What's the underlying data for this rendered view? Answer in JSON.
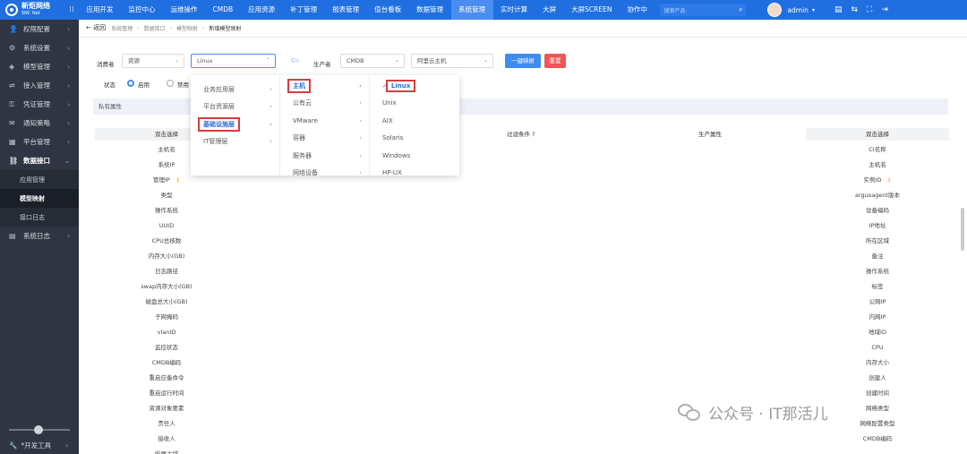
{
  "app": {
    "logo_line1": "新炬网络",
    "logo_line2": "SNC Net"
  },
  "nav": {
    "items": [
      "应用开发",
      "监控中心",
      "运维操作",
      "CMDB",
      "应用资源",
      "补丁管理",
      "报表管理",
      "值台看板",
      "数据管理",
      "系统管理",
      "实时计算",
      "大屏",
      "大屏SCREEN",
      "协作中"
    ],
    "active_index": 9,
    "search_placeholder": "搜索产品",
    "user": "admin"
  },
  "sidebar": {
    "items": [
      {
        "label": "权限配置",
        "icon": "user-icon"
      },
      {
        "label": "系统设置",
        "icon": "gear-icon"
      },
      {
        "label": "模型管理",
        "icon": "cube-icon"
      },
      {
        "label": "接入管理",
        "icon": "plug-icon"
      },
      {
        "label": "凭证管理",
        "icon": "key-icon"
      },
      {
        "label": "通知策略",
        "icon": "bell-icon"
      },
      {
        "label": "平台管理",
        "icon": "grid-icon"
      },
      {
        "label": "数据接口",
        "icon": "link-icon"
      }
    ],
    "subitems": [
      "应用管理",
      "模型映射",
      "接口日志"
    ],
    "active_sub": 1,
    "last_item": "系统日志",
    "dev_tools": "*开发工具"
  },
  "breadcrumb": {
    "back": "← 返回",
    "items": [
      "系统管理",
      "数据接口",
      "模型映射",
      "新增模型映射"
    ]
  },
  "form": {
    "consumer_label": "消费者",
    "consumer_value": "资源",
    "consumer_sub_value": "Linux",
    "producer_label": "生产者",
    "producer_value": "CMDB",
    "producer_sub_value": "阿里云主机",
    "btn_map": "一键映射",
    "btn_reset": "重置",
    "status_label": "状态",
    "status_on": "启用",
    "status_off": "禁用",
    "section_title": "私有属性"
  },
  "cascader": {
    "col1": [
      "业务应用层",
      "平台资源层",
      "基础设施层",
      "IT管理层"
    ],
    "col2": [
      "主机",
      "公有云",
      "VMware",
      "容器",
      "服务器",
      "网络设备"
    ],
    "col3": [
      "Linux",
      "Unix",
      "AIX",
      "Solaris",
      "Windows",
      "HP-UX"
    ]
  },
  "table": {
    "left_header": "双击选择",
    "filter_header": "过滤条件 ?",
    "producer_header": "生产属性",
    "right_header": "双击选择",
    "left_rows": [
      "主机名",
      "系统IP",
      "管理IP",
      "类型",
      "操作系统",
      "UUID",
      "CPU总核数",
      "内存大小(GB)",
      "日志路径",
      "swap内存大小(GB)",
      "磁盘总大小(GB)",
      "子网掩码",
      "vlanID",
      "监控状态",
      "CMDB编码",
      "重启应备命令",
      "重启运行时间",
      "资源对象要素",
      "责任人",
      "接收人",
      "所属主域"
    ],
    "right_rows": [
      "CI名称",
      "主机名",
      "实例ID",
      "argusagent版本",
      "设备编码",
      "IP地址",
      "所在区域",
      "备注",
      "操作系统",
      "标签",
      "公网IP",
      "内网IP",
      "地域ID",
      "CPU",
      "内存大小",
      "创建人",
      "创建时间",
      "网络类型",
      "网络配置类型",
      "CMDB编码"
    ]
  },
  "watermark": {
    "text": "公众号 · IT那活儿"
  }
}
